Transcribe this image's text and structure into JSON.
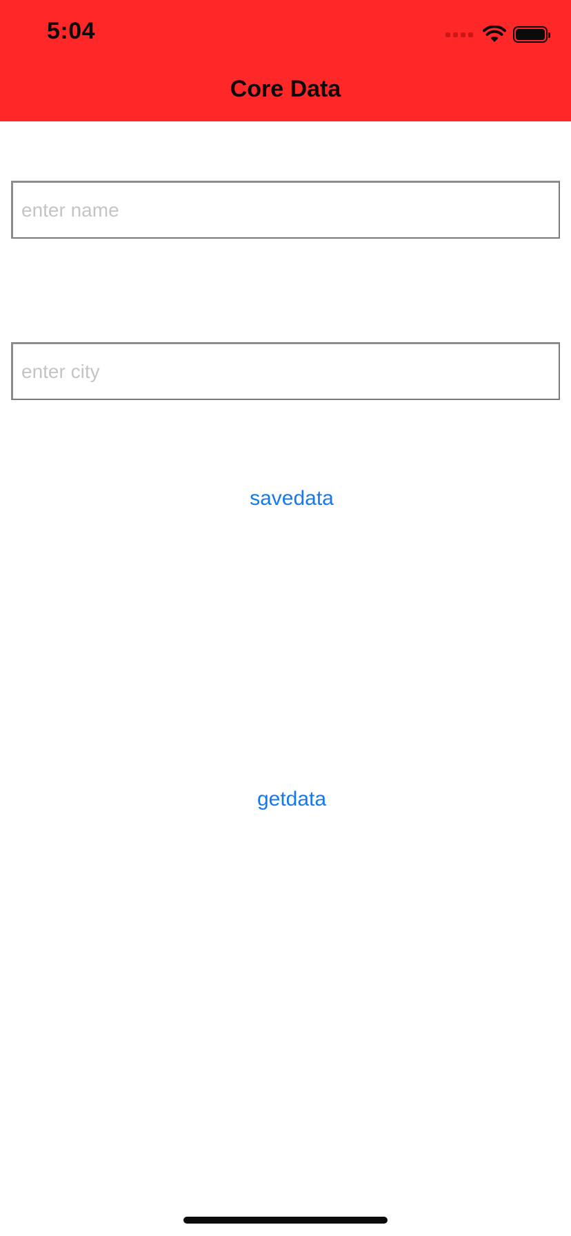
{
  "status_bar": {
    "time": "5:04",
    "icons": [
      "cellular-signal-icon",
      "wifi-icon",
      "battery-icon"
    ]
  },
  "nav_bar": {
    "title": "Core Data",
    "background_color": "#ff2828"
  },
  "form": {
    "name_field": {
      "placeholder": "enter name",
      "value": ""
    },
    "city_field": {
      "placeholder": "enter city",
      "value": ""
    },
    "save_button_label": "savedata",
    "get_button_label": "getdata",
    "link_color": "#1479f0"
  }
}
